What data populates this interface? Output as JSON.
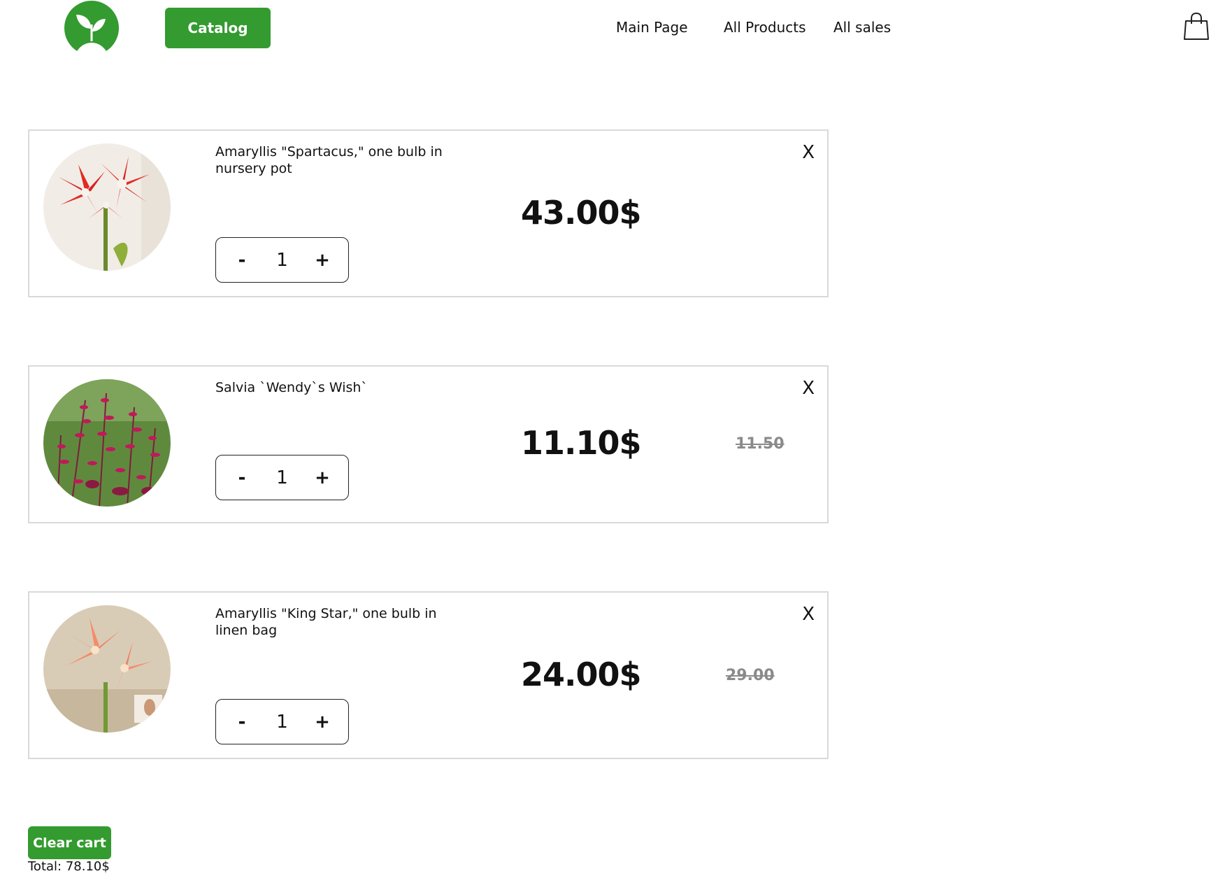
{
  "header": {
    "logo_icon": "leaf-sprout-icon",
    "brand_color": "#339b2f",
    "catalog_label": "Catalog",
    "nav": [
      {
        "label": "Main Page"
      },
      {
        "label": "All Products"
      },
      {
        "label": "All sales"
      }
    ],
    "cart_icon": "shopping-bag-icon"
  },
  "cart": {
    "items": [
      {
        "name": "Amaryllis \"Spartacus,\" one bulb in nursery pot",
        "image_icon": "red-white-amaryllis-photo",
        "quantity": "1",
        "minus_label": "-",
        "plus_label": "+",
        "price": "43.00$",
        "old_price": "",
        "remove_label": "X"
      },
      {
        "name": "Salvia `Wendy`s Wish`",
        "image_icon": "magenta-salvia-photo",
        "quantity": "1",
        "minus_label": "-",
        "plus_label": "+",
        "price": "11.10$",
        "old_price": "11.50",
        "remove_label": "X"
      },
      {
        "name": "Amaryllis \"King Star,\" one bulb in linen bag",
        "image_icon": "salmon-amaryllis-photo",
        "quantity": "1",
        "minus_label": "-",
        "plus_label": "+",
        "price": "24.00$",
        "old_price": "29.00",
        "remove_label": "X"
      }
    ]
  },
  "footer": {
    "clear_label": "Clear cart",
    "total_label": "Total: 78.10$"
  }
}
